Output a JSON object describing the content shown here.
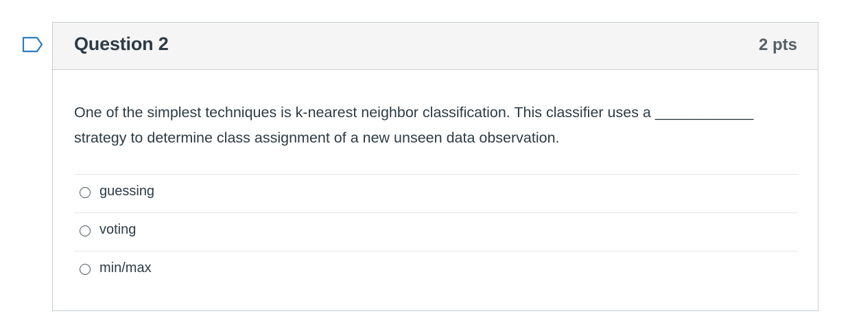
{
  "question": {
    "title": "Question 2",
    "points": "2 pts",
    "text": "One of the simplest techniques is k-nearest neighbor classification. This classifier uses a ____________ strategy to determine class assignment of a new unseen data observation.",
    "answers": [
      {
        "label": "guessing",
        "selected": false
      },
      {
        "label": "voting",
        "selected": false
      },
      {
        "label": "min/max",
        "selected": false
      }
    ]
  },
  "icons": {
    "flag": "bookmark-flag-icon",
    "radio": "radio-button-icon"
  },
  "colors": {
    "header_bg": "#f5f5f5",
    "border": "#c7cdd1",
    "flag_stroke": "#2b7abc",
    "text": "#2d3b45"
  }
}
